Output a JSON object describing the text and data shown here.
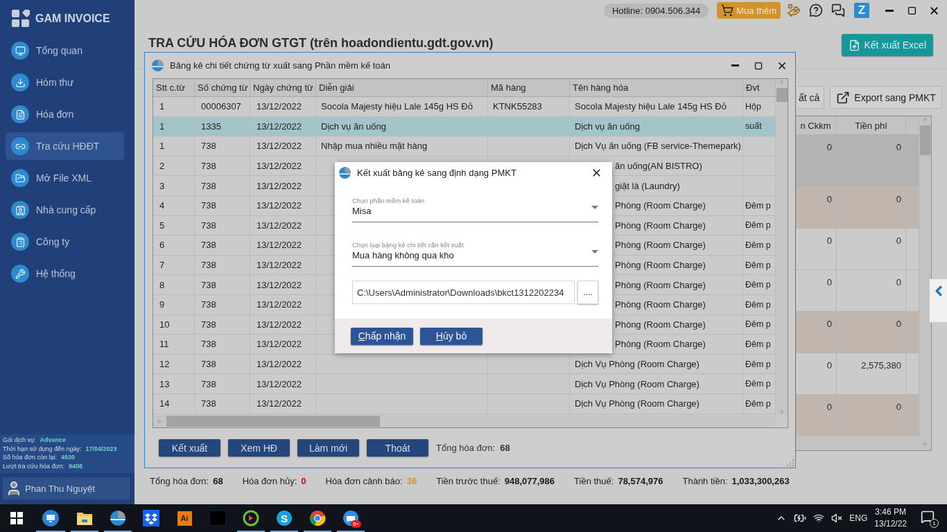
{
  "app": {
    "name": "GAM INVOICE"
  },
  "sidebar": {
    "items": [
      {
        "label": "Tổng quan",
        "selected": false
      },
      {
        "label": "Hòm thư",
        "selected": false
      },
      {
        "label": "Hóa đơn",
        "selected": false
      },
      {
        "label": "Tra cứu HĐĐT",
        "selected": true
      },
      {
        "label": "Mở File XML",
        "selected": false
      },
      {
        "label": "Nhà cung cấp",
        "selected": false
      },
      {
        "label": "Công ty",
        "selected": false
      },
      {
        "label": "Hệ thống",
        "selected": false
      }
    ],
    "service_info": [
      {
        "label": "Gói dịch vụ:",
        "value": "Advance"
      },
      {
        "label": "Thời hạn sử dụng đến ngày:",
        "value": "17/04/2023"
      },
      {
        "label": "Số hóa đơn còn lại:",
        "value": "4930"
      },
      {
        "label": "Lượt tra cứu hóa đơn:",
        "value": "9408"
      }
    ],
    "user": {
      "name": "Phan Thu Nguyệt"
    }
  },
  "top_bar": {
    "hotline": "Hotline: 0904.506.344",
    "buy_button": "Mua thêm",
    "icons": [
      {
        "kind": "money"
      },
      {
        "kind": "help"
      },
      {
        "kind": "support"
      },
      {
        "kind": "logo",
        "text": "Z"
      }
    ]
  },
  "page": {
    "title": "TRA CỨU HÓA ĐƠN GTGT (trên hoadondientu.gdt.gov.vn)",
    "excel_button": "Kết xuất Excel",
    "toolbar_buttons": [
      {
        "label": "ất cả",
        "kind": "plain"
      },
      {
        "label": "Export sang PMKT",
        "kind": "export"
      }
    ],
    "table": {
      "columns": [
        "n Ckkm",
        "Tiền phí"
      ],
      "rows": [
        {
          "cells": [
            "0",
            "0"
          ],
          "selected": true,
          "warning": false
        },
        {
          "cells": [
            "0",
            "0"
          ],
          "selected": false,
          "warning": true
        },
        {
          "cells": [
            "0",
            "0"
          ],
          "selected": false,
          "warning": false
        },
        {
          "cells": [
            "0",
            "0"
          ],
          "selected": false,
          "warning": false
        },
        {
          "cells": [
            "0",
            "0"
          ],
          "selected": false,
          "warning": true
        },
        {
          "cells": [
            "0",
            "2,575,380"
          ],
          "selected": false,
          "warning": false
        },
        {
          "cells": [
            "0",
            "0"
          ],
          "selected": false,
          "warning": true
        }
      ]
    },
    "totals": [
      {
        "label": "Tổng hóa đơn:",
        "value": "68",
        "color": "#1a1a1a"
      },
      {
        "label": "Hóa đơn hủy:",
        "value": "0",
        "color": "#e00000"
      },
      {
        "label": "Hóa đơn cảnh báo:",
        "value": "36",
        "color": "#d4901f"
      },
      {
        "label": "Tiền trước thuế:",
        "value": "948,077,986",
        "color": "#1a1a1a"
      },
      {
        "label": "Tiền thuế:",
        "value": "78,574,976",
        "color": "#1a1a1a"
      },
      {
        "label": "Thành tiền:",
        "value": "1,033,300,263",
        "color": "#1a1a1a"
      }
    ]
  },
  "detail_window": {
    "title": "Bảng kê chi tiết chứng từ xuất sang Phần mềm kế toán",
    "columns": [
      "Stt c.từ",
      "Số chứng từ",
      "Ngày chứng từ",
      "Diễn giải",
      "Mã hàng",
      "Tên hàng hóa",
      "Đvt"
    ],
    "rows": [
      {
        "cells": [
          "1",
          "00006307",
          "13/12/2022",
          "Socola Majesty hiệu Lale 145g HS Đỏ",
          "KTNK55283",
          "Socola Majesty hiệu Lale 145g HS Đỏ",
          "Hộp"
        ],
        "selected": false,
        "partial": false
      },
      {
        "cells": [
          "1",
          "1335",
          "13/12/2022",
          "Dịch vụ ăn uống",
          "",
          "Dịch vụ ăn uống",
          "suất"
        ],
        "selected": true,
        "partial": false
      },
      {
        "cells": [
          "1",
          "738",
          "13/12/2022",
          "Nhập mua nhiều mặt hàng",
          "",
          "Dịch Vụ ăn uống (FB service-Themepark)",
          ""
        ],
        "selected": false,
        "partial": false
      },
      {
        "cells": [
          "2",
          "738",
          "13/12/2022",
          "",
          "",
          "ăn uống(AN BISTRO)",
          ""
        ],
        "selected": false,
        "partial": true
      },
      {
        "cells": [
          "3",
          "738",
          "13/12/2022",
          "",
          "",
          "giặt là (Laundry)",
          ""
        ],
        "selected": false,
        "partial": true
      },
      {
        "cells": [
          "4",
          "738",
          "13/12/2022",
          "",
          "",
          "Phòng (Room Charge)",
          "Đêm p"
        ],
        "selected": false,
        "partial": true
      },
      {
        "cells": [
          "5",
          "738",
          "13/12/2022",
          "",
          "",
          "Phòng (Room Charge)",
          "Đêm p"
        ],
        "selected": false,
        "partial": true
      },
      {
        "cells": [
          "6",
          "738",
          "13/12/2022",
          "",
          "",
          "Phòng (Room Charge)",
          "Đêm p"
        ],
        "selected": false,
        "partial": true
      },
      {
        "cells": [
          "7",
          "738",
          "13/12/2022",
          "",
          "",
          "Phòng (Room Charge)",
          "Đêm p"
        ],
        "selected": false,
        "partial": true
      },
      {
        "cells": [
          "8",
          "738",
          "13/12/2022",
          "",
          "",
          "Phòng (Room Charge)",
          "Đêm p"
        ],
        "selected": false,
        "partial": true
      },
      {
        "cells": [
          "9",
          "738",
          "13/12/2022",
          "",
          "",
          "Phòng (Room Charge)",
          "Đêm p"
        ],
        "selected": false,
        "partial": true
      },
      {
        "cells": [
          "10",
          "738",
          "13/12/2022",
          "",
          "",
          "Phòng (Room Charge)",
          "Đêm p"
        ],
        "selected": false,
        "partial": true
      },
      {
        "cells": [
          "11",
          "738",
          "13/12/2022",
          "",
          "",
          "Phòng (Room Charge)",
          "Đêm p"
        ],
        "selected": false,
        "partial": true
      },
      {
        "cells": [
          "12",
          "738",
          "13/12/2022",
          "",
          "",
          "Dịch Vụ Phòng (Room Charge)",
          "Đêm p"
        ],
        "selected": false,
        "partial": false
      },
      {
        "cells": [
          "13",
          "738",
          "13/12/2022",
          "",
          "",
          "Dịch Vụ Phòng (Room Charge)",
          "Đêm p"
        ],
        "selected": false,
        "partial": false
      },
      {
        "cells": [
          "14",
          "738",
          "13/12/2022",
          "",
          "",
          "Dịch Vụ Phòng (Room Charge)",
          "Đêm p"
        ],
        "selected": false,
        "partial": false
      }
    ],
    "buttons": [
      "Kết xuất",
      "Xem HĐ",
      "Làm mới",
      "Thoát"
    ],
    "total_label": "Tổng hóa đơn:",
    "total_value": "68"
  },
  "export_dialog": {
    "title": "Kết xuất bảng kê sang định dạng PMKT",
    "fields": [
      {
        "label": "Chọn phần mềm kế toán",
        "value": "Misa"
      },
      {
        "label": "Chọn loại bảng kê chi tiết cần kết xuất",
        "value": "Mua hàng không qua kho"
      }
    ],
    "path": "C:\\Users\\Administrator\\Downloads\\bkct1312202234",
    "browse_button": "....",
    "buttons": [
      "Chấp nhận",
      "Hủy bỏ"
    ]
  },
  "taskbar": {
    "apps": [
      {
        "kind": "monitor",
        "running": true
      },
      {
        "kind": "folder",
        "running": true
      },
      {
        "kind": "pie",
        "running": true
      },
      {
        "kind": "box",
        "running": false
      },
      {
        "kind": "ai",
        "text": "Ai",
        "running": false
      },
      {
        "kind": "black",
        "running": false
      },
      {
        "kind": "ring",
        "running": true
      },
      {
        "kind": "skype",
        "text": "S",
        "running": true
      },
      {
        "kind": "wheel",
        "running": true
      },
      {
        "kind": "chat",
        "badge": "5+",
        "running": true
      }
    ],
    "language": "ENG",
    "time": "3:46 PM",
    "date": "13/12/22",
    "notifications": "1"
  }
}
